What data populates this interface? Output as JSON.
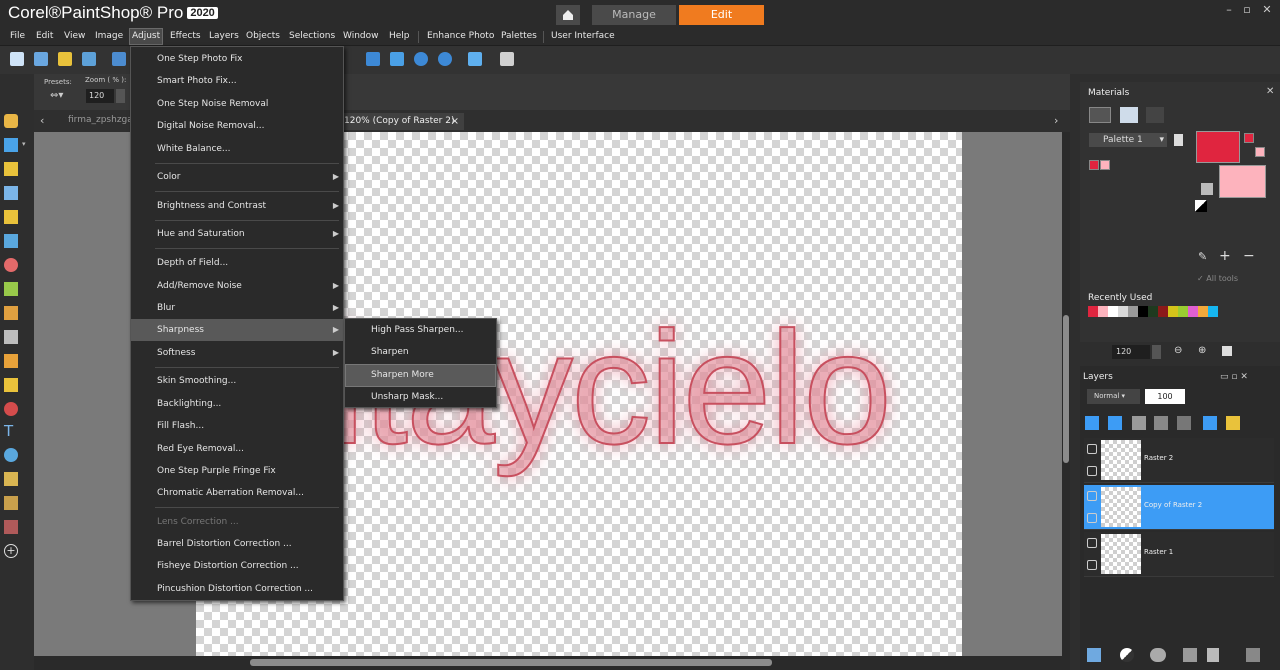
{
  "app": {
    "logo_corel": "Corel",
    "logo_name": "PaintShop",
    "logo_pro": "Pro",
    "logo_year": "2020",
    "tab_manage": "Manage",
    "tab_edit": "Edit",
    "accent": "#f07b1f"
  },
  "menubar": [
    "File",
    "Edit",
    "View",
    "Image",
    "Adjust",
    "Effects",
    "Layers",
    "Objects",
    "Selections",
    "Window",
    "Help",
    "Enhance Photo",
    "Palettes",
    "User Interface"
  ],
  "options": {
    "presets_label": "Presets:",
    "zoom_label": "Zoom ( % ):",
    "zoom_value": "120"
  },
  "documents": {
    "tab1": "firma_zpshzgav",
    "tab2": "120% (Copy of Raster 2)",
    "close": "×"
  },
  "canvas_text": "itaycielo",
  "adjust_menu": [
    {
      "label": "One Step Photo Fix"
    },
    {
      "label": "Smart Photo Fix..."
    },
    {
      "label": "One Step Noise Removal"
    },
    {
      "label": "Digital Noise Removal..."
    },
    {
      "label": "White Balance..."
    },
    {
      "label": "Color",
      "submenu": true
    },
    {
      "label": "Brightness and Contrast",
      "submenu": true
    },
    {
      "label": "Hue and Saturation",
      "submenu": true
    },
    {
      "label": "Depth of Field..."
    },
    {
      "label": "Add/Remove Noise",
      "submenu": true
    },
    {
      "label": "Blur",
      "submenu": true
    },
    {
      "label": "Sharpness",
      "submenu": true,
      "highlight": true
    },
    {
      "label": "Softness",
      "submenu": true
    },
    {
      "label": "Skin Smoothing..."
    },
    {
      "label": "Backlighting..."
    },
    {
      "label": "Fill Flash..."
    },
    {
      "label": "Red Eye Removal..."
    },
    {
      "label": "One Step Purple Fringe Fix"
    },
    {
      "label": "Chromatic Aberration Removal..."
    },
    {
      "label": "Lens Correction ...",
      "disabled": true
    },
    {
      "label": "Barrel Distortion Correction ..."
    },
    {
      "label": "Fisheye Distortion Correction ..."
    },
    {
      "label": "Pincushion Distortion Correction ..."
    }
  ],
  "sharpness_menu": [
    {
      "label": "High Pass Sharpen..."
    },
    {
      "label": "Sharpen"
    },
    {
      "label": "Sharpen More",
      "highlight": true
    },
    {
      "label": "Unsharp Mask..."
    }
  ],
  "materials": {
    "title": "Materials",
    "palette": "Palette 1",
    "all_tools": "All tools",
    "recently_used": "Recently Used",
    "fg_color": "#e0253f",
    "bg_color": "#fdb3bd",
    "recent_colors": [
      "#e0253f",
      "#fdb3bd",
      "#ffffff",
      "#d9d9d9",
      "#9a9a9a",
      "#000000",
      "#1f3a1f",
      "#8b1a1a",
      "#d4c41a",
      "#9acd32",
      "#e05fd0",
      "#f2a93b",
      "#16b6f0"
    ]
  },
  "navigator": {
    "zoom": "120"
  },
  "layers": {
    "title": "Layers",
    "blend_mode": "Normal",
    "opacity": "100",
    "items": [
      {
        "name": "Raster 2",
        "selected": false
      },
      {
        "name": "Copy of Raster 2",
        "selected": true
      },
      {
        "name": "Raster 1",
        "selected": false
      }
    ]
  }
}
